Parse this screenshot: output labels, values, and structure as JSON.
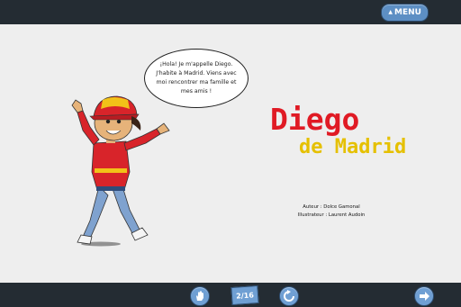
{
  "header": {
    "menu_label": "MENU"
  },
  "story": {
    "speech_bubble": "¡Hola! Je m'appelle Diego. J'habite à Madrid. Viens avec moi rencontrer ma famille et mes amis !",
    "title_line1": "Diego",
    "title_line2": "de Madrid",
    "author": "Auteur : Dolce Gamonal",
    "illustrator": "Illustrateur : Laurent Audoin"
  },
  "footer": {
    "page_counter": "2/16",
    "icons": [
      "hand-icon",
      "replay-icon",
      "next-arrow-icon"
    ]
  },
  "colors": {
    "bar": "#242c33",
    "button": "#6f9fd3",
    "title_red": "#e01a24",
    "title_yellow": "#e5c000"
  }
}
